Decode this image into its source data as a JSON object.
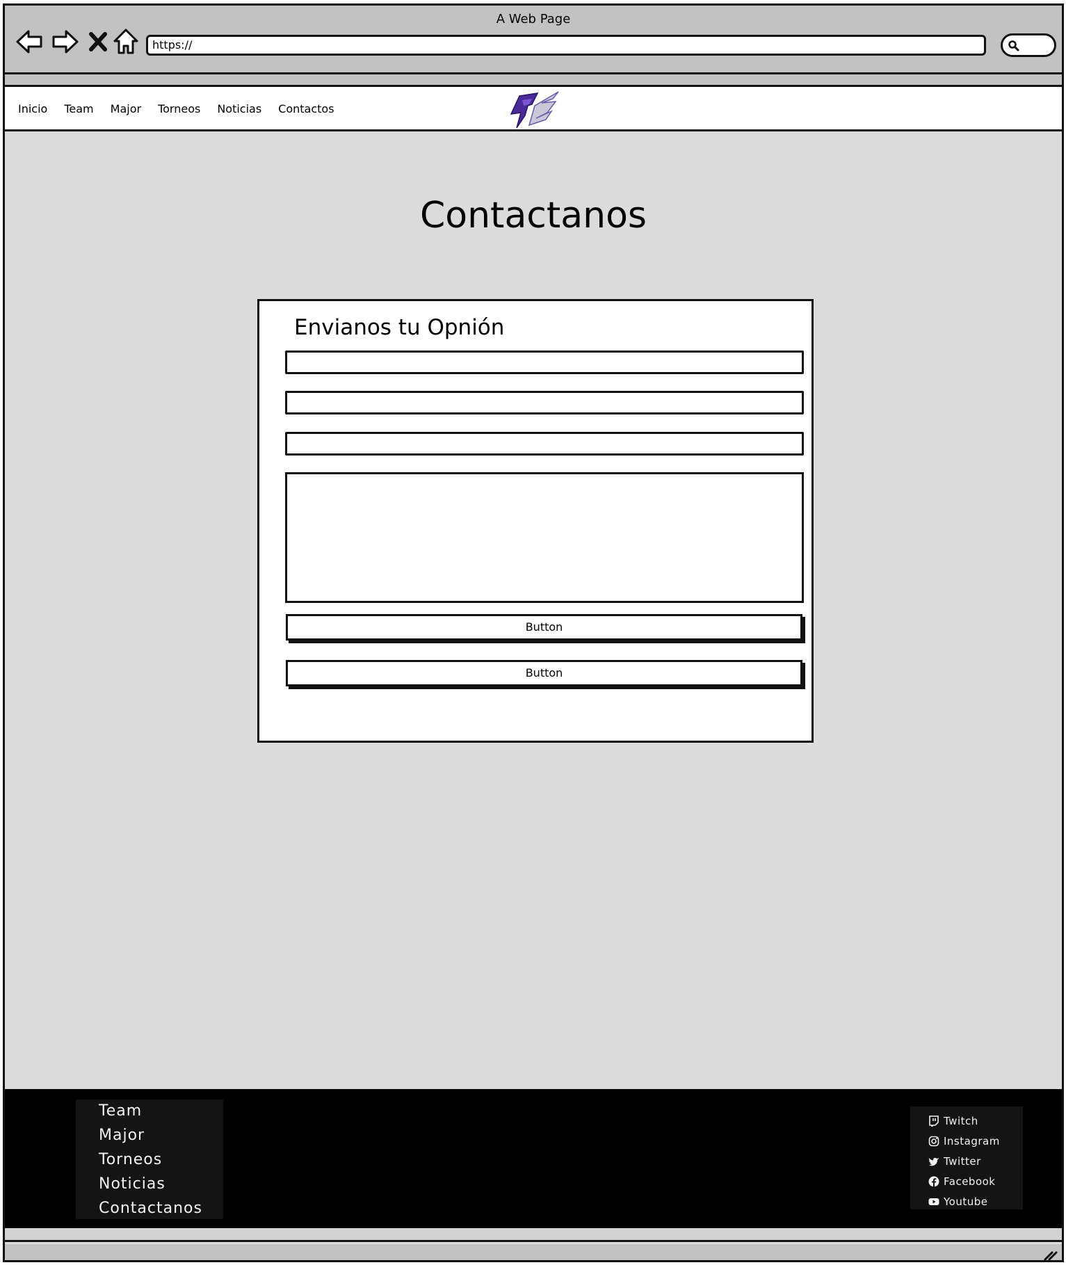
{
  "browser": {
    "title": "A Web Page",
    "url": "https://"
  },
  "site_nav": [
    "Inicio",
    "Team",
    "Major",
    "Torneos",
    "Noticias",
    "Contactos"
  ],
  "main": {
    "title": "Contactanos"
  },
  "form": {
    "title": "Envianos tu Opnión",
    "buttons": [
      "Button",
      "Button"
    ]
  },
  "footer": {
    "links": [
      "Team",
      "Major",
      "Torneos",
      "Noticias",
      "Contactanos"
    ],
    "social": [
      {
        "label": "Twitch",
        "icon": "twitch-icon"
      },
      {
        "label": "Instagram",
        "icon": "instagram-icon"
      },
      {
        "label": "Twitter",
        "icon": "twitter-icon"
      },
      {
        "label": "Facebook",
        "icon": "facebook-icon"
      },
      {
        "label": "Youtube",
        "icon": "youtube-icon"
      }
    ]
  },
  "colors": {
    "page_bg": "#dcdcdc",
    "chrome_bg": "#c2c2c2",
    "footer_bg": "#000000",
    "logo_purple": "#4b2a9a"
  }
}
